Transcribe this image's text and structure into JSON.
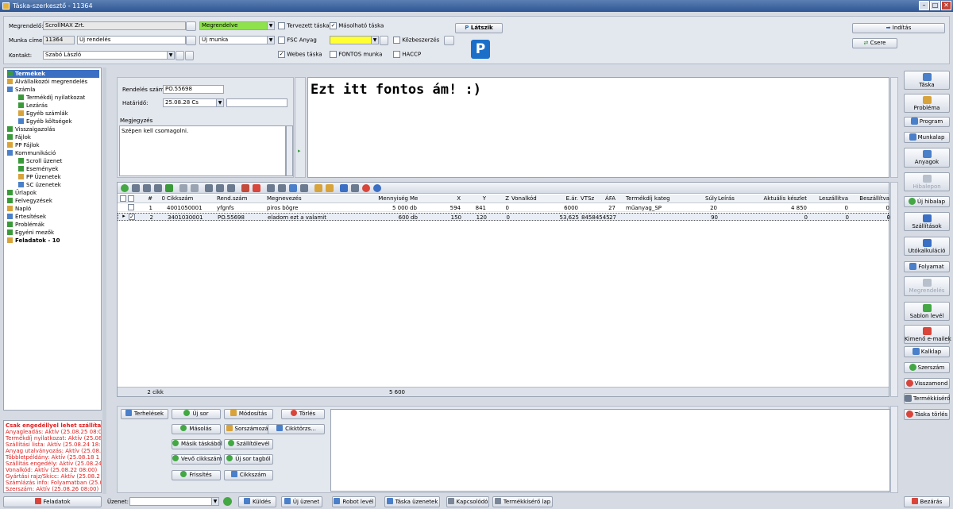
{
  "window": {
    "title": "Táska-szerkesztő - 11364"
  },
  "header": {
    "megrendelo_label": "Megrendelő:",
    "megrendelo_value": "ScrollMAX Zrt.",
    "munka_cime_label": "Munka címe:",
    "munka_szam": "11364",
    "munka_cime_value": "Új rendelés",
    "kontakt_label": "Kontakt:",
    "kontakt_value": "Szabó László",
    "status_value": "Megrendelve",
    "munka_tipus_value": "Új munka",
    "tervezett_taska": "Tervezett táska",
    "masolhato_taska": "Másolható táska",
    "fsc_anyag": "FSC Anyag",
    "kozbeszerzes": "Közbeszerzés",
    "webes_taska": "Webes táska",
    "fontos_munka": "FONTOS munka",
    "haccp": "HACCP",
    "latszik_label": "Látszik",
    "inditas_label": "Indítás",
    "csere_label": "Csere"
  },
  "tree": {
    "items": [
      {
        "label": "Termékek",
        "level": 0,
        "selected": true
      },
      {
        "label": "Alvállalkozói megrendelés",
        "level": 0
      },
      {
        "label": "Számla",
        "level": 0
      },
      {
        "label": "Termékdíj nyilatkozat",
        "level": 1
      },
      {
        "label": "Lezárás",
        "level": 1
      },
      {
        "label": "Egyéb számlák",
        "level": 1
      },
      {
        "label": "Egyéb költségek",
        "level": 1
      },
      {
        "label": "Visszaigazolás",
        "level": 0
      },
      {
        "label": "Fájlok",
        "level": 0
      },
      {
        "label": "PP Fájlok",
        "level": 0
      },
      {
        "label": "Kommunikáció",
        "level": 0
      },
      {
        "label": "Scroll üzenet",
        "level": 1
      },
      {
        "label": "Események",
        "level": 1
      },
      {
        "label": "PP Üzenetek",
        "level": 1
      },
      {
        "label": "SC üzenetek",
        "level": 1
      },
      {
        "label": "Űrlapok",
        "level": 0
      },
      {
        "label": "Felvegyzések",
        "level": 0
      },
      {
        "label": "Napló",
        "level": 0
      },
      {
        "label": "Értesítések",
        "level": 0
      },
      {
        "label": "Problémák",
        "level": 0
      },
      {
        "label": "Egyéni mezők",
        "level": 0
      },
      {
        "label": "Feladatok - 10",
        "level": 0,
        "bold": true
      }
    ]
  },
  "log": {
    "lines": [
      {
        "text": "Csak engedéllyel lehet szállíta",
        "bold": true
      },
      {
        "text": "Anyagleadás: Aktív (25.08.25 08:0"
      },
      {
        "text": "Termékdíj nyilatkozat: Aktív (25.08"
      },
      {
        "text": "Szállítási lista: Aktív (25.08.24 18:0"
      },
      {
        "text": "Anyag utalványozás: Aktív (25.08.2"
      },
      {
        "text": "Többletpéldány: Aktív (25.08.18 1"
      },
      {
        "text": "Szállítás engedély: Aktív (25.08.24"
      },
      {
        "text": "Vonalkód: Aktív (25.08.22 08:00)"
      },
      {
        "text": "Gyártási rajz/Skicc: Aktív (25.08.2"
      },
      {
        "text": "Számlázás info: Folyamatban (25.0"
      },
      {
        "text": "Szerszám: Aktív (25.08.26 08:00)"
      }
    ]
  },
  "order_form": {
    "rendeles_szam_label": "Rendelés szám:",
    "rendeles_szam_value": "PO.55698",
    "hatarido_label": "Határidő:",
    "hatarido_value": "25.08.28 Cs",
    "megjegyzes_label": "Megjegyzés",
    "megjegyzes_value": "Szépen kell csomagolni."
  },
  "bigtext": {
    "value": "Ezt itt fontos ám! :)"
  },
  "grid": {
    "columns": [
      "#",
      "0",
      "Cikkszám",
      "Rend.szám",
      "Megnevezés",
      "Mennyiség",
      "Me",
      "X",
      "Y",
      "Z",
      "Vonalkód",
      "E.ár.",
      "VTSz",
      "ÁFA",
      "Termékdíj kateg",
      "Súly",
      "Leírás",
      "Aktuális készlet",
      "Leszállítva",
      "Beszállítva"
    ],
    "rows": [
      {
        "n": "1",
        "cikkszam": "4001050001",
        "rendszam": "yfgnfs",
        "megnevezes": "piros bögre",
        "mennyiseg": "5 000",
        "me": "db",
        "x": "594",
        "y": "841",
        "z": "0",
        "vonalkod": "",
        "ear": "6000",
        "vtsz": "",
        "afa": "27",
        "termekdij": "műanyag_SP",
        "suly": "20",
        "leiras": "",
        "keszlet": "4 850",
        "leszallitva": "0",
        "beszallitva": "0"
      },
      {
        "n": "2",
        "cikkszam": "3401030001",
        "rendszam": "PO.55698",
        "megnevezes": "eladom ezt a valamit",
        "mennyiseg": "600",
        "me": "db",
        "x": "150",
        "y": "120",
        "z": "0",
        "vonalkod": "",
        "ear": "53,625",
        "vtsz": "84584545",
        "afa": "27",
        "termekdij": "",
        "suly": "90",
        "leiras": "",
        "keszlet": "0",
        "leszallitva": "0",
        "beszallitva": "0"
      }
    ],
    "footer_count": "2 cikk",
    "footer_sum": "5 600"
  },
  "actions": {
    "terhelesek": "Terhelések",
    "uj_sor": "Új sor",
    "modositas": "Módosítás",
    "torles": "Törlés",
    "masolas": "Másolás",
    "sorszamozas": "Sorszámozás",
    "cikktorzs": "Cikktörzs...",
    "masik_taskabol": "Másik táskából",
    "szallitolevel": "Szállítólevél",
    "vevo_cikkszam": "Vevő cikkszám",
    "uj_sor_tagbol": "Új sor tagból",
    "frissites": "Frissítés",
    "cikkszam": "Cikkszám"
  },
  "right_buttons": [
    {
      "label": "Táska",
      "disabled": false
    },
    {
      "label": "Probléma",
      "disabled": false
    },
    {
      "label": "Program",
      "disabled": false
    },
    {
      "label": "Munkalap",
      "disabled": false
    },
    {
      "label": "Anyagok",
      "disabled": false
    },
    {
      "label": "Hibalepon",
      "disabled": true
    },
    {
      "label": "Új hibalap",
      "disabled": false
    },
    {
      "label": "Szállítások",
      "disabled": false
    },
    {
      "label": "Utókalkuláció",
      "disabled": false
    },
    {
      "label": "Folyamat",
      "disabled": false
    },
    {
      "label": "Megrendelés",
      "disabled": true
    },
    {
      "label": "Sablon levél",
      "disabled": false
    },
    {
      "label": "Kimenő e-mailek",
      "disabled": false
    },
    {
      "label": "Kalklap",
      "disabled": false
    },
    {
      "label": "Szerszám",
      "disabled": false
    },
    {
      "label": "Visszamond",
      "disabled": false
    },
    {
      "label": "Termékkísérő",
      "disabled": false
    },
    {
      "label": "Táska törlés",
      "disabled": false
    }
  ],
  "statusbar": {
    "feladatok_label": "Feladatok",
    "uzenet_label": "Üzenet:",
    "kuldes": "Küldés",
    "uj_uzenet": "Új üzenet",
    "robot_level": "Robot levél",
    "taska_uzenetek": "Táska üzenetek",
    "kapcsolodo": "Kapcsolódó",
    "termekkisero_lap": "Termékkísérő lap",
    "bezaras": "Bezárás"
  }
}
